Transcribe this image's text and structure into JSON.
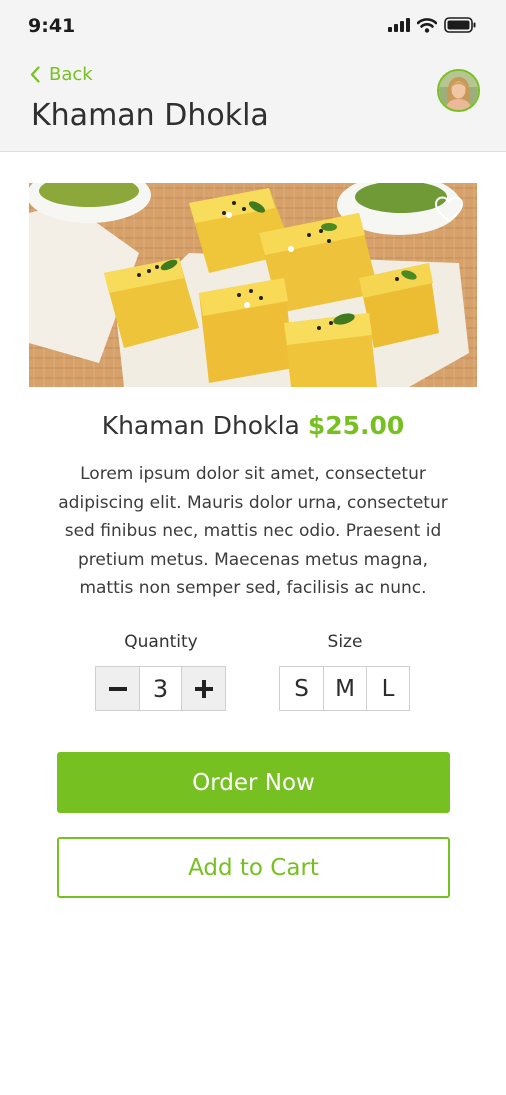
{
  "status_bar": {
    "time": "9:41"
  },
  "header": {
    "back_label": "Back",
    "title": "Khaman Dhokla"
  },
  "product": {
    "name": "Khaman Dhokla",
    "price": "$25.00",
    "description": "Lorem ipsum dolor sit amet, consectetur adipiscing elit. Mauris dolor urna, consectetur sed finibus nec, mattis nec odio. Praesent id pretium metus. Maecenas metus magna, mattis non semper sed, facilisis ac nunc."
  },
  "quantity": {
    "label": "Quantity",
    "minus": "−",
    "value": "3",
    "plus": "+"
  },
  "size": {
    "label": "Size",
    "options": [
      "S",
      "M",
      "L"
    ]
  },
  "actions": {
    "order": "Order Now",
    "cart": "Add to Cart"
  },
  "colors": {
    "accent": "#76c121",
    "header_bg": "#f4f4f4",
    "text": "#333333"
  },
  "icons": [
    "signal-icon",
    "wifi-icon",
    "battery-icon",
    "chevron-left-icon",
    "heart-icon"
  ]
}
